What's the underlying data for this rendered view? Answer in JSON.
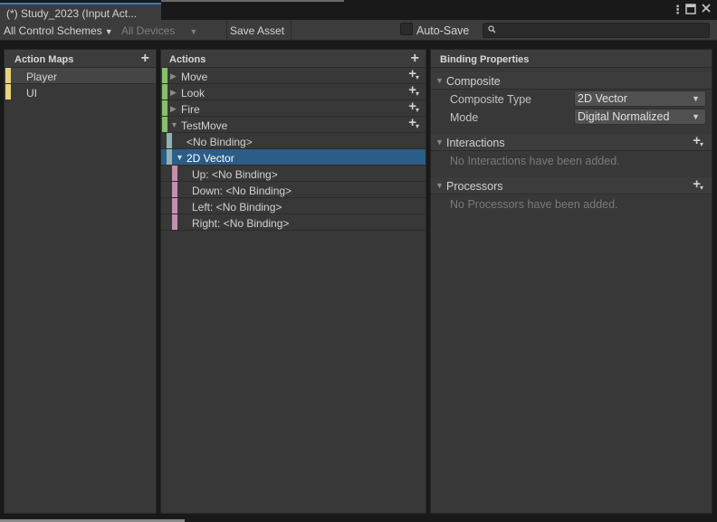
{
  "window": {
    "tab_title": "(*) Study_2023 (Input Act...",
    "menu_icon": "kebab-menu-icon",
    "maximize_icon": "maximize-icon",
    "close_icon": "close-icon"
  },
  "toolbar": {
    "control_schemes": "All Control Schemes",
    "devices": "All Devices",
    "save_asset": "Save Asset",
    "auto_save": "Auto-Save",
    "auto_save_checked": false,
    "search_placeholder": ""
  },
  "action_maps": {
    "header": "Action Maps",
    "items": [
      {
        "label": "Player",
        "color": "#e8d27c",
        "selected": true
      },
      {
        "label": "UI",
        "color": "#e8d27c",
        "selected": false
      }
    ]
  },
  "actions": {
    "header": "Actions",
    "rows": [
      {
        "label": "Move",
        "type": "action",
        "color": "#86c06c"
      },
      {
        "label": "Look",
        "type": "action",
        "color": "#86c06c"
      },
      {
        "label": "Fire",
        "type": "action",
        "color": "#86c06c"
      },
      {
        "label": "TestMove",
        "type": "action",
        "color": "#86c06c",
        "expanded": true
      },
      {
        "label": "<No Binding>",
        "type": "binding",
        "color": "#8fb3b3"
      },
      {
        "label": "2D Vector",
        "type": "composite",
        "color": "#8fb3b3",
        "expanded": true,
        "selected": true
      },
      {
        "label": "Up: <No Binding>",
        "type": "part",
        "color": "#c48fb0"
      },
      {
        "label": "Down: <No Binding>",
        "type": "part",
        "color": "#c48fb0"
      },
      {
        "label": "Left: <No Binding>",
        "type": "part",
        "color": "#c48fb0"
      },
      {
        "label": "Right: <No Binding>",
        "type": "part",
        "color": "#c48fb0"
      }
    ]
  },
  "binding_properties": {
    "header": "Binding Properties",
    "composite": {
      "title": "Composite",
      "composite_type_label": "Composite Type",
      "composite_type_value": "2D Vector",
      "mode_label": "Mode",
      "mode_value": "Digital Normalized"
    },
    "interactions": {
      "title": "Interactions",
      "empty": "No Interactions have been added."
    },
    "processors": {
      "title": "Processors",
      "empty": "No Processors have been added."
    }
  }
}
